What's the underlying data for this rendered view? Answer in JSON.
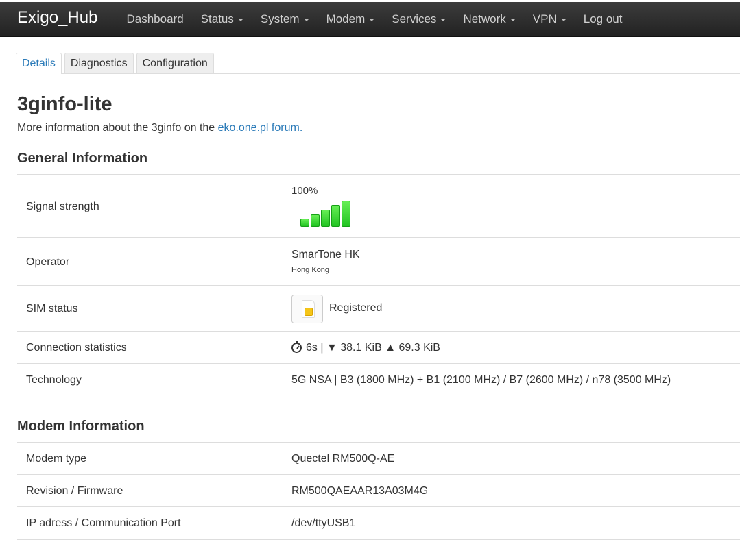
{
  "brand": "Exigo_Hub",
  "nav": [
    {
      "label": "Dashboard",
      "dropdown": false
    },
    {
      "label": "Status",
      "dropdown": true
    },
    {
      "label": "System",
      "dropdown": true
    },
    {
      "label": "Modem",
      "dropdown": true
    },
    {
      "label": "Services",
      "dropdown": true
    },
    {
      "label": "Network",
      "dropdown": true
    },
    {
      "label": "VPN",
      "dropdown": true
    },
    {
      "label": "Log out",
      "dropdown": false
    }
  ],
  "tabs": [
    {
      "label": "Details",
      "active": true
    },
    {
      "label": "Diagnostics",
      "active": false
    },
    {
      "label": "Configuration",
      "active": false
    }
  ],
  "page": {
    "title": "3ginfo-lite",
    "description_prefix": "More information about the 3ginfo on the ",
    "description_link": "eko.one.pl forum."
  },
  "general": {
    "title": "General Information",
    "signal": {
      "label": "Signal strength",
      "value": "100%",
      "bars": 5,
      "bars_lit": 5
    },
    "operator": {
      "label": "Operator",
      "name": "SmarTone HK",
      "country": "Hong Kong"
    },
    "sim": {
      "label": "SIM status",
      "value": "Registered"
    },
    "connection": {
      "label": "Connection statistics",
      "time": "6s",
      "separator": " | ",
      "down_arrow": "▼",
      "down": "38.1 KiB",
      "up_arrow": "▲",
      "up": "69.3 KiB"
    },
    "technology": {
      "label": "Technology",
      "value": "5G NSA | B3 (1800 MHz) + B1 (2100 MHz) / B7 (2600 MHz) / n78 (3500 MHz)"
    }
  },
  "modem": {
    "title": "Modem Information",
    "type": {
      "label": "Modem type",
      "value": "Quectel RM500Q-AE"
    },
    "revision": {
      "label": "Revision / Firmware",
      "value": "RM500QAEAAR13A03M4G"
    },
    "port": {
      "label": "IP adress / Communication Port",
      "value": "/dev/ttyUSB1"
    }
  },
  "colors": {
    "accent": "#2a7ab8",
    "navbar": "#2a2a2a",
    "signal_bar": "#33dd33"
  }
}
